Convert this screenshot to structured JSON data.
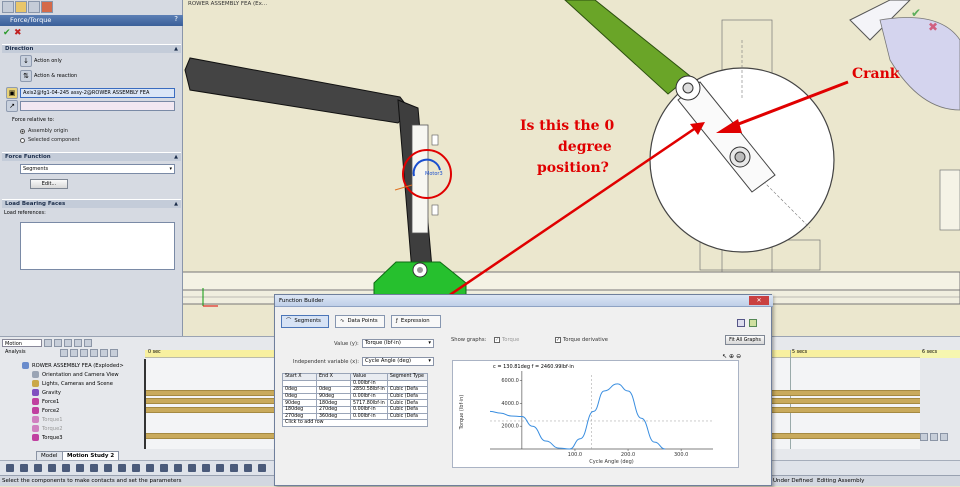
{
  "viewport": {
    "part_tab_label": "ROWER ASSEMBLY FEA  (Ex...",
    "motor_label": "Motor3",
    "annotation": {
      "crank": "Crank",
      "question_line1": "Is this the 0",
      "question_line2": "degree",
      "question_line3": "position?"
    },
    "colors": {
      "annotation": "#e00000",
      "tube": "#4a4a4a",
      "arm": "#6aa528",
      "foot": "#26c02e"
    }
  },
  "property_manager": {
    "title": "Force/Torque",
    "help": "?",
    "ok": "✔",
    "cancel": "✖",
    "direction": {
      "header": "Direction",
      "action_only": "Action only",
      "action_reaction": "Action & reaction",
      "face_field": "Axis2@fg1-04-245 assy-2@ROWER ASSEMBLY FEA",
      "force_relative_to": "Force relative to:",
      "opt_assembly_origin": "Assembly origin",
      "opt_selected_component": "Selected component"
    },
    "force_function": {
      "header": "Force Function",
      "type": "Segments",
      "edit_button": "Edit..."
    },
    "load_bearing": {
      "header": "Load Bearing Faces",
      "load_references": "Load references:"
    }
  },
  "motion_manager": {
    "study_type": "Motion Analysis",
    "time_markers": [
      "0 sec",
      "5 secs",
      "6 secs"
    ],
    "tree": [
      {
        "label": "ROWER ASSEMBLY FEA  (Exploded>",
        "color": "#6a8ccc"
      },
      {
        "label": "Orientation and Camera View",
        "color": "#9aa4b4"
      },
      {
        "label": "Lights, Cameras and Scene",
        "color": "#caa84a"
      },
      {
        "label": "Gravity",
        "color": "#8050c0"
      },
      {
        "label": "Force1",
        "color": "#c040a0"
      },
      {
        "label": "Force2",
        "color": "#c040a0"
      },
      {
        "label": "Torque1",
        "color": "#d080c0"
      },
      {
        "label": "Torque2",
        "color": "#d080c0"
      },
      {
        "label": "Torque3",
        "color": "#c040a0"
      }
    ],
    "tabs": [
      "Model",
      "Motion Study 2"
    ]
  },
  "function_builder": {
    "title": "Function Builder",
    "tabs": [
      "Segments",
      "Data Points",
      "Expression"
    ],
    "value_label": "Value (y):",
    "value_select": "Torque (lbf·in)",
    "indep_label": "Independent variable (x):",
    "indep_select": "Cycle Angle (deg)",
    "table_headers": [
      "Start X",
      "End X",
      "Value",
      "Segment Type"
    ],
    "table_rows": [
      [
        "",
        "",
        "0.00lbf·in",
        ""
      ],
      [
        "0deg",
        "0deg",
        "2850.58lbf·in",
        "Cubic (Defa"
      ],
      [
        "0deg",
        "90deg",
        "0.00lbf·in",
        "Cubic (Defa"
      ],
      [
        "90deg",
        "180deg",
        "5717.80lbf·in",
        "Cubic (Defa"
      ],
      [
        "180deg",
        "270deg",
        "0.00lbf·in",
        "Cubic (Defa"
      ],
      [
        "270deg",
        "360deg",
        "0.00lbf·in",
        "Cubic (Defa"
      ]
    ],
    "add_row": "Click to add row",
    "show_graphs": "Show graphs:",
    "chk_torque": "Torque",
    "chk_derivative": "Torque derivative",
    "fit_all": "Fit All Graphs",
    "readout": "c = 130.81deg  f = 2460.99lbf·in",
    "chart_data": {
      "type": "line",
      "xlabel": "Cycle Angle (deg)",
      "ylabel": "Torque (lbf·in)",
      "xticks": [
        "100.0",
        "200.0",
        "300.0"
      ],
      "yticks": [
        "6000.0",
        "4000.0",
        "2000.0"
      ],
      "xlim": [
        -60,
        360
      ],
      "ylim": [
        0,
        6500
      ],
      "x": [
        -60,
        -40,
        -20,
        0,
        20,
        45,
        70,
        90,
        110,
        135,
        155,
        180,
        200,
        225,
        250,
        270
      ],
      "y": [
        3300,
        3150,
        2900,
        2850,
        2000,
        700,
        80,
        0,
        900,
        3300,
        5100,
        5720,
        5100,
        2700,
        600,
        0
      ]
    }
  },
  "status_bar": {
    "left": "Select the components to make contacts and set the parameters",
    "state": "Under Defined",
    "mode": "Editing Assembly"
  }
}
